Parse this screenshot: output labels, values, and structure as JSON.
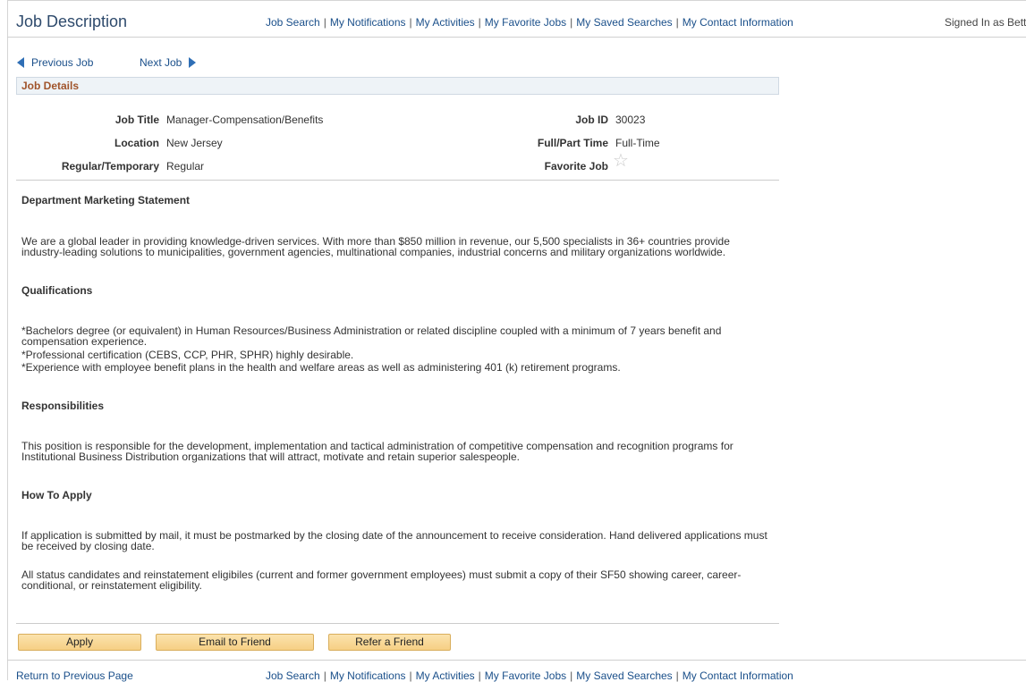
{
  "header": {
    "title": "Job Description",
    "signed_in": "Signed In as Bett"
  },
  "nav": {
    "items": [
      "Job Search",
      "My Notifications",
      "My Activities",
      "My Favorite Jobs",
      "My Saved Searches",
      "My Contact Information"
    ]
  },
  "job_nav": {
    "previous": "Previous Job",
    "next": "Next Job"
  },
  "details": {
    "section_title": "Job Details",
    "job_title_label": "Job Title",
    "job_title_value": "Manager-Compensation/Benefits",
    "location_label": "Location",
    "location_value": "New Jersey",
    "regular_label": "Regular/Temporary",
    "regular_value": "Regular",
    "job_id_label": "Job ID",
    "job_id_value": "30023",
    "fullpart_label": "Full/Part Time",
    "fullpart_value": "Full-Time",
    "favorite_label": "Favorite Job",
    "favorite_glyph": "☆"
  },
  "sections": {
    "marketing_title": "Department Marketing Statement",
    "marketing_text": "We are a global leader in providing knowledge-driven services. With more than $850 million in revenue, our 5,500 specialists in 36+ countries provide industry-leading solutions to municipalities, government agencies, multinational companies, industrial concerns and military organizations worldwide.",
    "qualifications_title": "Qualifications",
    "qual_1": "*Bachelors degree (or equivalent) in Human Resources/Business Administration or related discipline coupled with a minimum of 7 years benefit and compensation experience.",
    "qual_2": "*Professional certification (CEBS, CCP, PHR, SPHR) highly desirable.",
    "qual_3": "*Experience with employee benefit plans in the health and welfare areas as well as administering 401 (k) retirement programs.",
    "responsibilities_title": "Responsibilities",
    "responsibilities_text": "This position is responsible for the development, implementation and tactical administration of competitive compensation and recognition programs for Institutional Business Distribution organizations that will attract, motivate and retain superior salespeople.",
    "apply_title": "How To Apply",
    "apply_text_1": " If application is submitted by mail, it must be postmarked by the closing date of the announcement to receive consideration.  Hand delivered applications must be received by closing date.",
    "apply_text_2": "All status candidates and reinstatement eligibiles (current and former government employees) must submit a copy of their SF50 showing career, career-conditional, or reinstatement eligibility."
  },
  "buttons": {
    "apply": "Apply",
    "email": "Email to Friend",
    "refer": "Refer a Friend"
  },
  "footer": {
    "return": "Return to Previous Page"
  }
}
